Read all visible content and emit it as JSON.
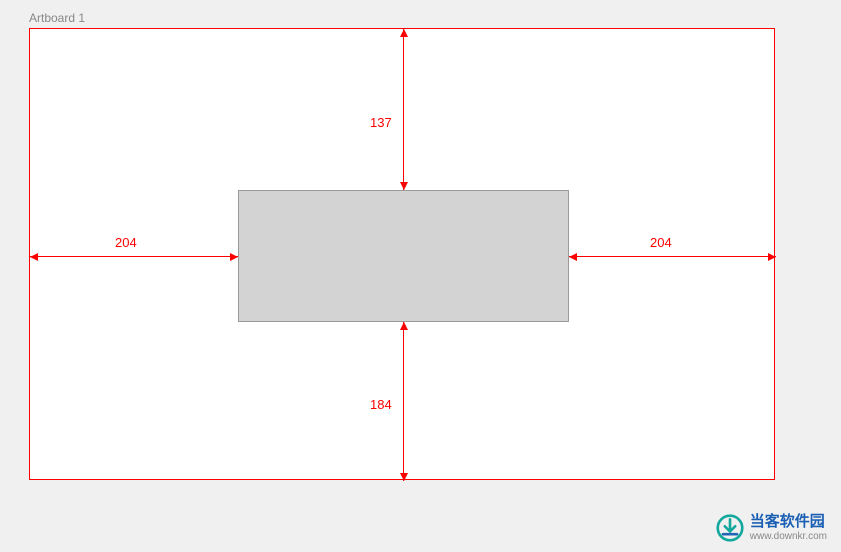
{
  "artboard": {
    "label": "Artboard 1"
  },
  "measurements": {
    "top": "137",
    "bottom": "184",
    "left": "204",
    "right": "204"
  },
  "watermark": {
    "title": "当客软件园",
    "url": "www.downkr.com"
  }
}
